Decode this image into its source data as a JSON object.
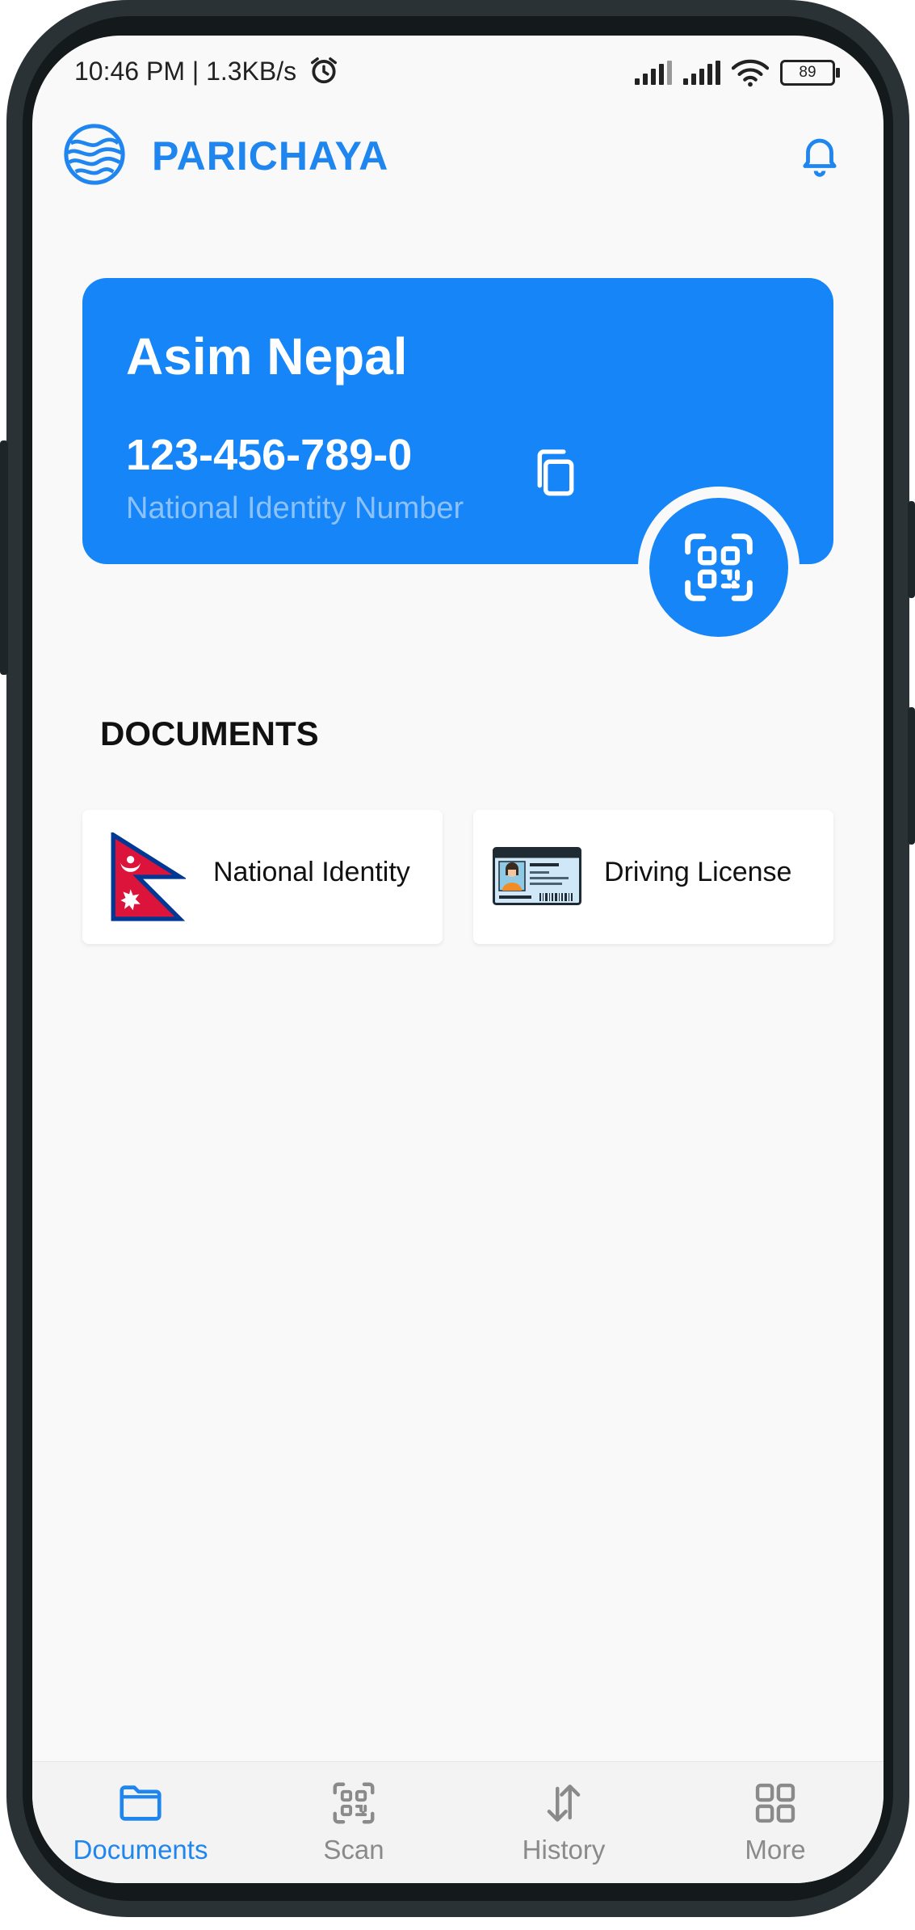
{
  "status_bar": {
    "time_and_speed": "10:46 PM | 1.3KB/s",
    "battery": "89",
    "icons": [
      "alarm-icon",
      "signal-icon",
      "signal-icon",
      "wifi-icon",
      "battery-icon"
    ]
  },
  "app_bar": {
    "title": "PARICHAYA",
    "logo_icon": "globe-logo-icon",
    "notification_icon": "bell-icon"
  },
  "id_card": {
    "name": "Asim Nepal",
    "number": "123-456-789-0",
    "number_label": "National Identity Number",
    "copy_icon": "copy-icon",
    "qr_icon": "qr-code-icon"
  },
  "documents": {
    "heading": "DOCUMENTS",
    "items": [
      {
        "label": "National Identity",
        "icon": "nepal-flag-icon"
      },
      {
        "label": "Driving License",
        "icon": "driving-license-icon"
      }
    ]
  },
  "bottom_nav": {
    "items": [
      {
        "label": "Documents",
        "icon": "folder-icon",
        "active": true
      },
      {
        "label": "Scan",
        "icon": "scan-icon",
        "active": false
      },
      {
        "label": "History",
        "icon": "history-arrows-icon",
        "active": false
      },
      {
        "label": "More",
        "icon": "grid-icon",
        "active": false
      }
    ]
  },
  "colors": {
    "accent": "#1585f7",
    "brand_text": "#1f86f0",
    "background": "#f9f9f9",
    "frame": "#2a3236"
  }
}
